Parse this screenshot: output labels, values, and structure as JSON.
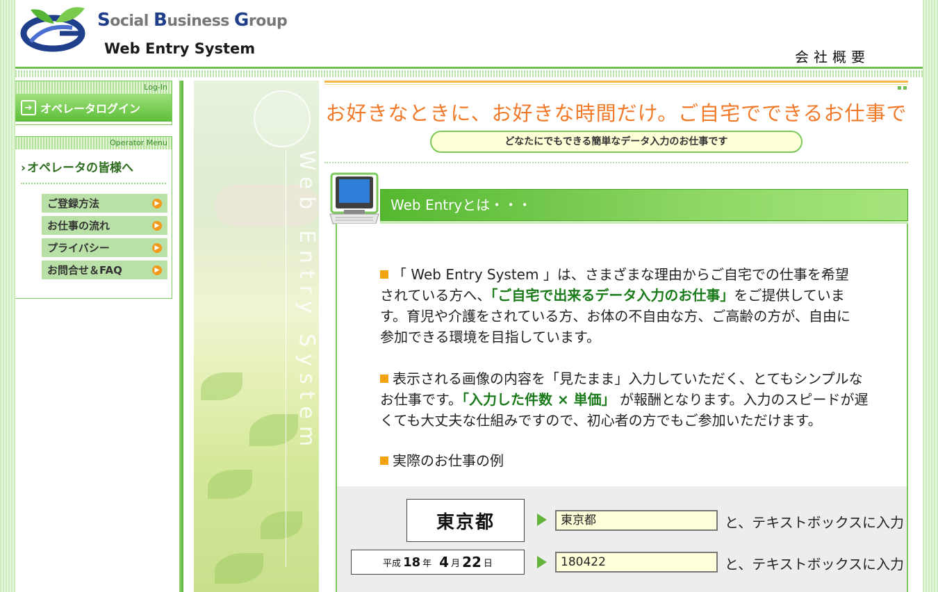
{
  "header": {
    "brand_parts": [
      "S",
      "ocial ",
      "B",
      "usiness ",
      "G",
      "roup"
    ],
    "system_name": "Web Entry System",
    "company_link": "会社概要"
  },
  "sidebar": {
    "login_tag": "Log-In",
    "login_button": "オペレータログイン",
    "menu_tag": "Operator Menu",
    "menu_title": "オペレータの皆様へ",
    "items": [
      {
        "label": "ご登録方法"
      },
      {
        "label": "お仕事の流れ"
      },
      {
        "label": "プライバシー"
      },
      {
        "label": "お問合せ＆FAQ"
      }
    ]
  },
  "photo": {
    "vertical_text": "Web Entry System"
  },
  "main": {
    "catchphrase": "お好きなときに、お好きな時間だけ。ご自宅でできるお仕事です",
    "subtitle": "どなたにでもできる簡単なデータ入力のお仕事です",
    "section_title": "Web Entryとは・・・",
    "p1_a": "「 Web Entry System 」は、さまざまな理由からご自宅での仕事を希望されている方へ、",
    "p1_hl": "「ご自宅で出来るデータ入力のお仕事」",
    "p1_b": "をご提供しています。育児や介護をされている方、お体の不自由な方、ご高齢の方が、自由に参加できる環境を目指しています。",
    "p2_a": "表示される画像の内容を「見たまま」入力していただく、とてもシンプルなお仕事です。",
    "p2_hl": "「入力した件数 × 単価」",
    "p2_b": " が報酬となります。入力のスピードが遅くても大丈夫な仕組みですので、初心者の方でもご参加いただけます。",
    "p3": "実際のお仕事の例",
    "examples": [
      {
        "image_text": "東京都",
        "input_value": "東京都",
        "tail": "と、テキストボックスに入力"
      },
      {
        "image_parts": [
          "平成",
          "18",
          "年",
          "4",
          "月",
          "22",
          "日"
        ],
        "input_value": "180422",
        "tail": "と、テキストボックスに入力"
      }
    ]
  },
  "colors": {
    "accent_green": "#5cbf38",
    "accent_orange": "#f07a2a",
    "bullet_orange": "#f3a310"
  }
}
